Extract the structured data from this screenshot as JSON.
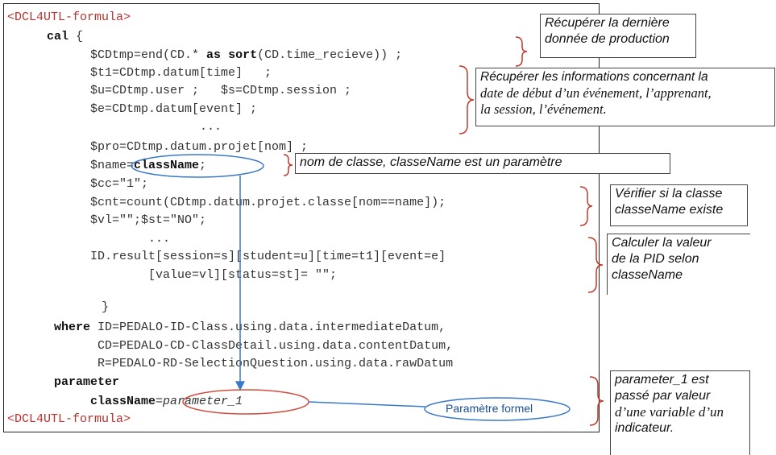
{
  "code": {
    "open_tag": "<DCL4UTL-formula>",
    "cal_kw": "cal",
    "cal_brace": " {",
    "line_cdtmp_a": "$CDtmp=end(CD.* ",
    "line_cdtmp_as": "as",
    "line_cdtmp_b": " ",
    "line_cdtmp_sort": "sort",
    "line_cdtmp_c": "(CD.time_recieve)) ;",
    "line_t1": "$t1=CDtmp.datum[time]   ;",
    "line_u": "$u=CDtmp.user ;   $s=CDtmp.session ;",
    "line_e": "$e=CDtmp.datum[event] ;",
    "dots1": "...",
    "line_pro": "$pro=CDtmp.datum.projet[nom] ;",
    "line_name_a": "$name=",
    "line_name_b": "className",
    "line_name_c": ";",
    "line_cc": "$cc=\"1\";",
    "line_cnt": "$cnt=count(CDtmp.datum.projet.classe[nom==name]);",
    "line_vl": "$vl=\"\";$st=\"NO\";",
    "dots2": "...",
    "line_result1": "ID.result[session=s][student=u][time=t1][event=e]",
    "line_result2": "[value=vl][status=st]= \"\";",
    "close_brace": "}",
    "where_kw": "where",
    "where_1": " ID=PEDALO-ID-Class.using.data.intermediateDatum,",
    "where_2": "CD=PEDALO-CD-ClassDetail.using.data.contentDatum,",
    "where_3": "R=PEDALO-RD-SelectionQuestion.using.data.rawDatum",
    "parameter_kw": "parameter",
    "param_a": "className",
    "param_b": "=",
    "param_c": "parameter_1",
    "close_tag": "<DCL4UTL-formula>"
  },
  "notes": {
    "n1": [
      "Récupérer la dernière",
      "donnée de production"
    ],
    "n2_title": "Récupérer les informations concernant la",
    "n2_rest": [
      "date de début d’un événement, l’apprenant,",
      "la session, l’événement."
    ],
    "n3": "nom de classe, classeName est un paramètre",
    "n4": [
      "Vérifier si la classe",
      "classeName existe"
    ],
    "n5": [
      "Calculer la valeur",
      "de la PID selon",
      "classeName"
    ],
    "n6_sans": [
      "parameter_1 est",
      "passé par valeur"
    ],
    "n6_serif": [
      "d’une variable d’un",
      "indicateur."
    ]
  },
  "formal_param_label": "Paramètre formel",
  "colors": {
    "tag": "#b8312f",
    "arrow": "#3a78c9",
    "ellipse": "#d24b3c",
    "bracket": "#c0392b"
  }
}
